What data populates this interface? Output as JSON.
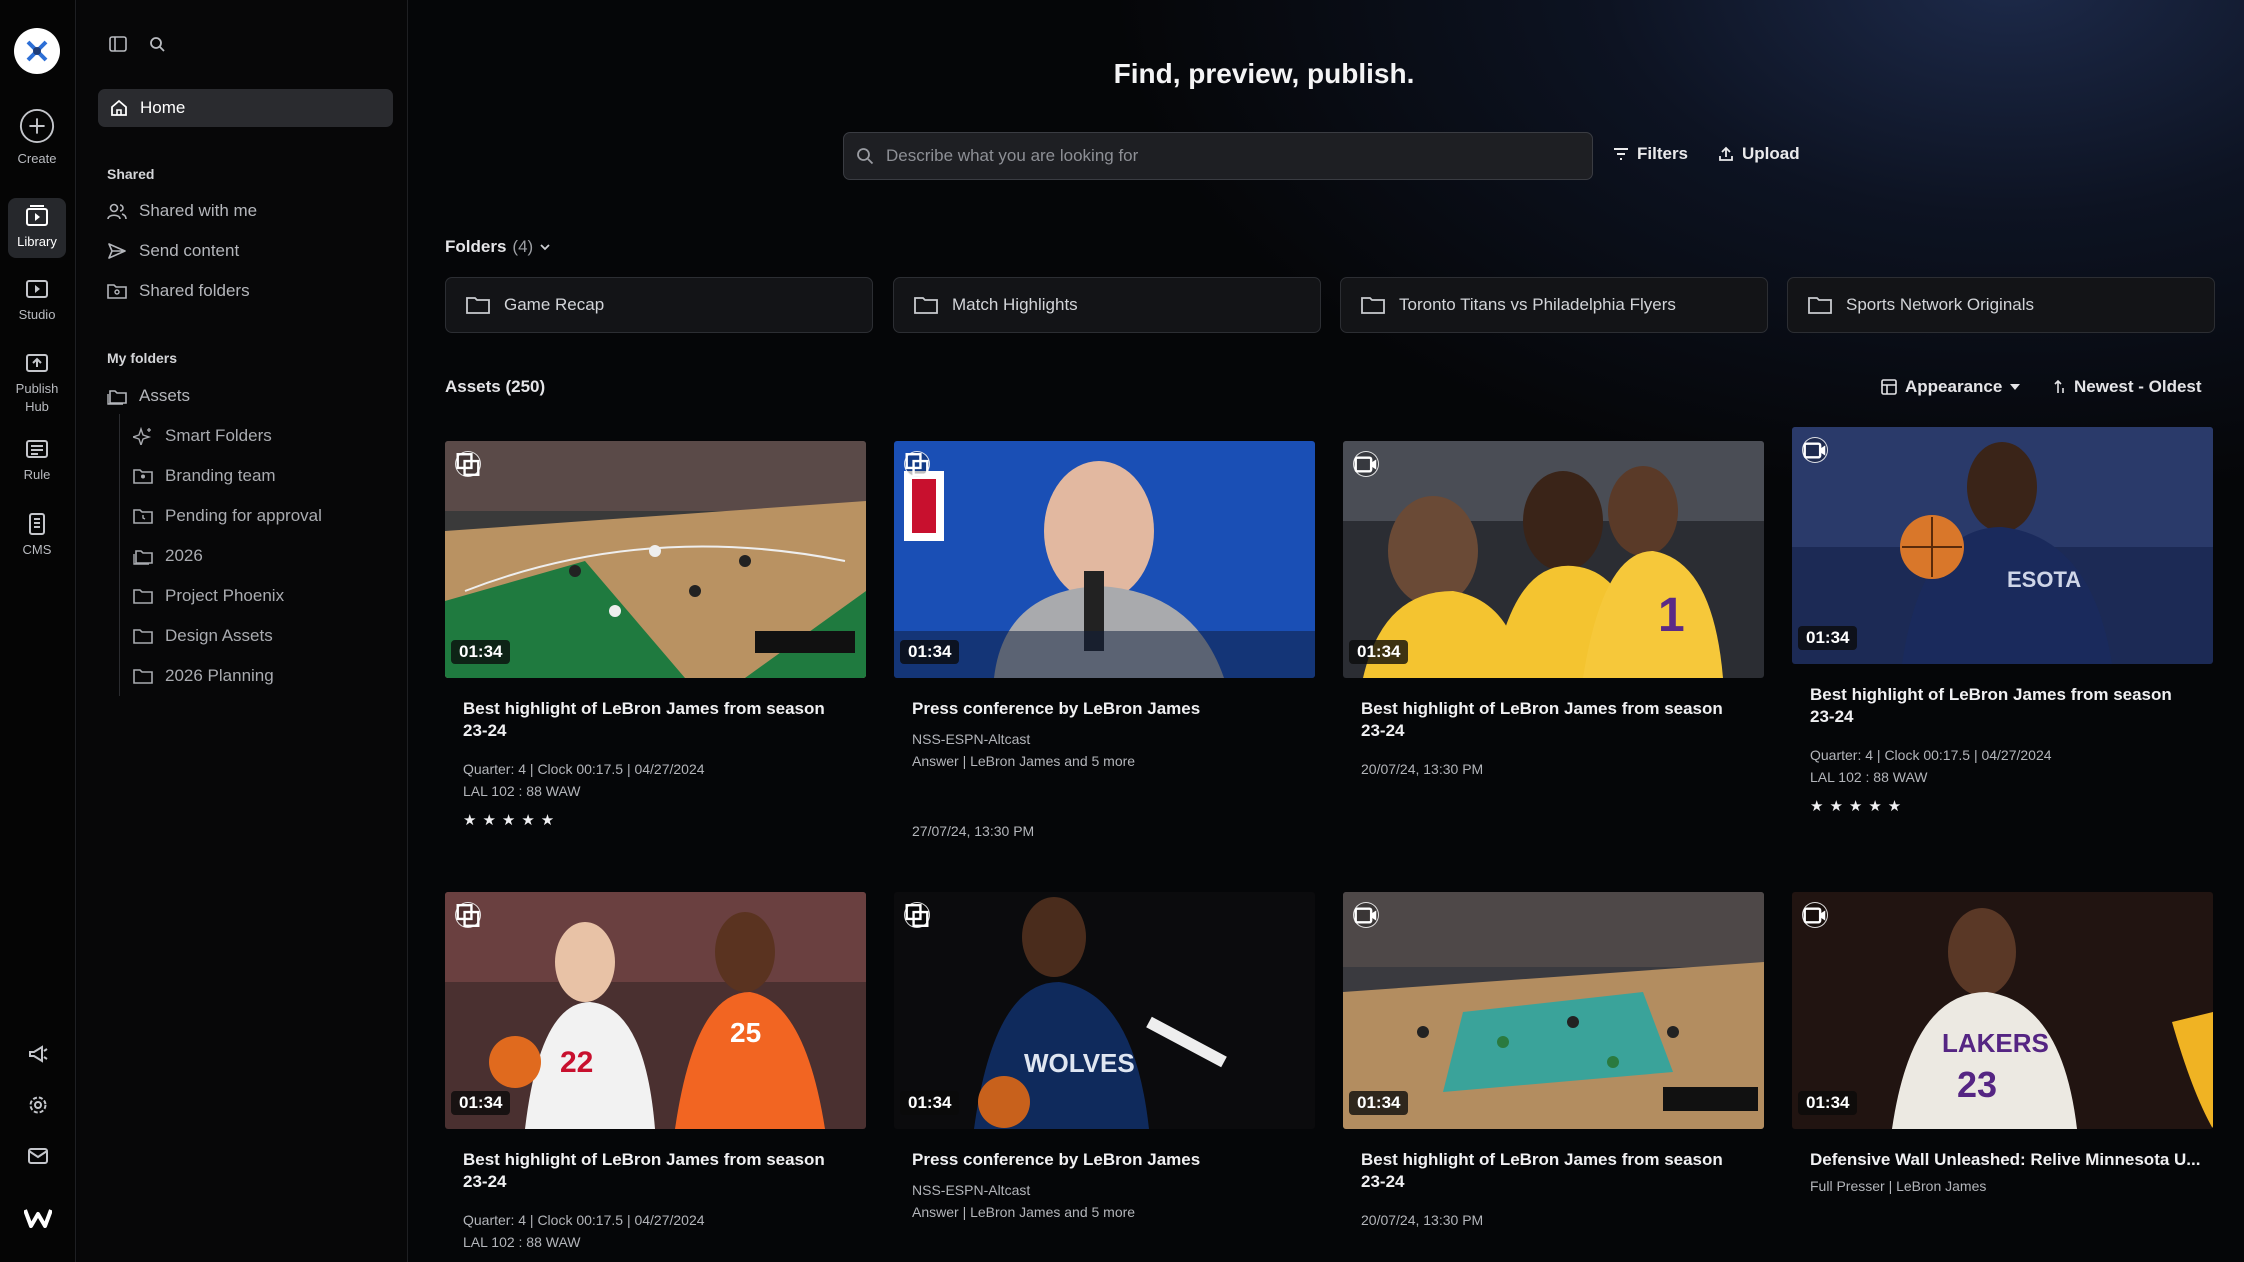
{
  "rail": {
    "create_label": "Create",
    "items": [
      {
        "label": "Library",
        "icon": "library-icon"
      },
      {
        "label": "Studio",
        "icon": "studio-icon"
      },
      {
        "label": "Publish Hub",
        "icon": "publish-hub-icon"
      },
      {
        "label": "Rule",
        "icon": "rule-icon"
      },
      {
        "label": "CMS",
        "icon": "cms-icon"
      }
    ]
  },
  "sidebar": {
    "home_label": "Home",
    "shared_title": "Shared",
    "shared_items": [
      "Shared with me",
      "Send content",
      "Shared folders"
    ],
    "my_folders_title": "My folders",
    "assets_label": "Assets",
    "sub_items": [
      "Smart Folders",
      "Branding team",
      "Pending for approval",
      "2026",
      "Project Phoenix",
      "Design Assets",
      "2026 Planning"
    ]
  },
  "header": {
    "title": "Find, preview, publish.",
    "search_placeholder": "Describe what you are looking for",
    "filters_label": "Filters",
    "upload_label": "Upload"
  },
  "folders": {
    "label": "Folders",
    "count": "(4)",
    "items": [
      "Game Recap",
      "Match Highlights",
      "Toronto Titans vs Philadelphia Flyers",
      "Sports Network Originals"
    ]
  },
  "assets": {
    "label": "Assets (250)",
    "appearance_label": "Appearance",
    "sort_label": "Newest - Oldest",
    "cards": [
      {
        "duration": "01:34",
        "title": "Best highlight of LeBron James from season 23-24",
        "line1": "Quarter: 4 | Clock 00:17.5 | 04/27/2024",
        "line2": "LAL 102 : 88 WAW",
        "stars": "★★★★★",
        "type_icon": "clip-icon"
      },
      {
        "duration": "01:34",
        "title": "Press conference by LeBron James",
        "line1": "NSS-ESPN-Altcast",
        "line2": "Answer | LeBron James and 5 more",
        "date": "27/07/24, 13:30 PM",
        "type_icon": "clip-icon"
      },
      {
        "duration": "01:34",
        "title": "Best highlight of LeBron James from season 23-24",
        "date": "20/07/24, 13:30 PM",
        "type_icon": "video-icon"
      },
      {
        "duration": "01:34",
        "title": "Best highlight of LeBron James from season 23-24",
        "line1": "Quarter: 4 | Clock 00:17.5 | 04/27/2024",
        "line2": "LAL 102 : 88 WAW",
        "stars": "★★★★★",
        "type_icon": "video-icon"
      },
      {
        "duration": "01:34",
        "title": "Best highlight of LeBron James from season 23-24",
        "line1": "Quarter: 4 | Clock 00:17.5 | 04/27/2024",
        "line2": "LAL 102 : 88 WAW",
        "type_icon": "clip-icon"
      },
      {
        "duration": "01:34",
        "title": "Press conference by LeBron James",
        "line1": "NSS-ESPN-Altcast",
        "line2": "Answer | LeBron James and 5 more",
        "type_icon": "clip-icon"
      },
      {
        "duration": "01:34",
        "title": "Best highlight of LeBron James from season 23-24",
        "date": "20/07/24, 13:30 PM",
        "type_icon": "video-icon"
      },
      {
        "duration": "01:34",
        "title": "Defensive Wall Unleashed: Relive Minnesota U...",
        "line1": "Full Presser | LeBron James",
        "type_icon": "video-icon"
      }
    ]
  }
}
